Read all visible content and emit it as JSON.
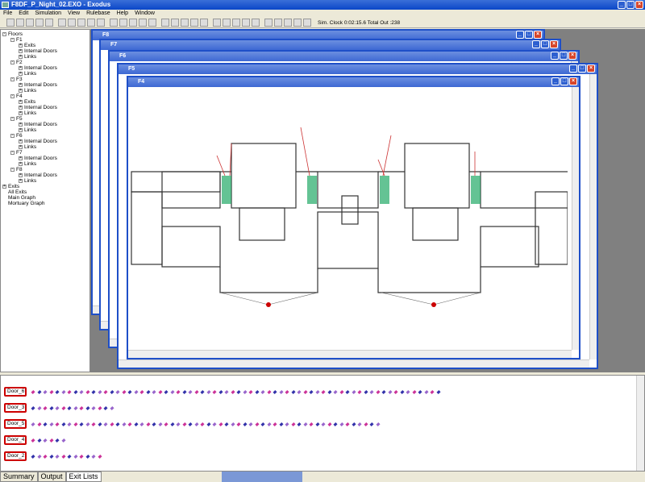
{
  "app": {
    "title": "F8DF_P_Night_02.EXO - Exodus"
  },
  "menu": [
    "File",
    "Edit",
    "Simulation",
    "View",
    "Rulebase",
    "Help",
    "Window"
  ],
  "status": {
    "sim_clock": "Sim. Clock   0:02:15.6 Total Out :238"
  },
  "tree": [
    {
      "label": "Floors",
      "level": 0,
      "exp": "-"
    },
    {
      "label": "F1",
      "level": 1,
      "exp": "-"
    },
    {
      "label": "Exits",
      "level": 2,
      "exp": "+"
    },
    {
      "label": "Internal Doors",
      "level": 2,
      "exp": "+"
    },
    {
      "label": "Links",
      "level": 2,
      "exp": "+"
    },
    {
      "label": "F2",
      "level": 1,
      "exp": "-"
    },
    {
      "label": "Internal Doors",
      "level": 2,
      "exp": "+"
    },
    {
      "label": "Links",
      "level": 2,
      "exp": "+"
    },
    {
      "label": "F3",
      "level": 1,
      "exp": "-"
    },
    {
      "label": "Internal Doors",
      "level": 2,
      "exp": "+"
    },
    {
      "label": "Links",
      "level": 2,
      "exp": "+"
    },
    {
      "label": "F4",
      "level": 1,
      "exp": "-"
    },
    {
      "label": "Exits",
      "level": 2,
      "exp": "+"
    },
    {
      "label": "Internal Doors",
      "level": 2,
      "exp": "+"
    },
    {
      "label": "Links",
      "level": 2,
      "exp": "+"
    },
    {
      "label": "F5",
      "level": 1,
      "exp": "-"
    },
    {
      "label": "Internal Doors",
      "level": 2,
      "exp": "+"
    },
    {
      "label": "Links",
      "level": 2,
      "exp": "+"
    },
    {
      "label": "F6",
      "level": 1,
      "exp": "-"
    },
    {
      "label": "Internal Doors",
      "level": 2,
      "exp": "+"
    },
    {
      "label": "Links",
      "level": 2,
      "exp": "+"
    },
    {
      "label": "F7",
      "level": 1,
      "exp": "-"
    },
    {
      "label": "Internal Doors",
      "level": 2,
      "exp": "+"
    },
    {
      "label": "Links",
      "level": 2,
      "exp": "+"
    },
    {
      "label": "F8",
      "level": 1,
      "exp": "-"
    },
    {
      "label": "Internal Doors",
      "level": 2,
      "exp": "+"
    },
    {
      "label": "Links",
      "level": 2,
      "exp": "+"
    },
    {
      "label": "Exits",
      "level": 0,
      "exp": "+"
    },
    {
      "label": "All Exits",
      "level": 0,
      "exp": ""
    },
    {
      "label": "Main Graph",
      "level": 0,
      "exp": ""
    },
    {
      "label": "Mortuary Graph",
      "level": 0,
      "exp": ""
    }
  ],
  "windows": [
    "F8",
    "F7",
    "F6",
    "F5",
    "F4"
  ],
  "exits": [
    {
      "label": "Door_6",
      "count": 68
    },
    {
      "label": "Door_3",
      "count": 14
    },
    {
      "label": "Door_5",
      "count": 58
    },
    {
      "label": "Door_4",
      "count": 6
    },
    {
      "label": "Door_2",
      "count": 12
    }
  ],
  "tabs": [
    "Summary",
    "Output",
    "Exit Lists"
  ],
  "colors": {
    "dotA": "#cc3399",
    "dotB": "#3333aa",
    "dotC": "#9966cc"
  }
}
